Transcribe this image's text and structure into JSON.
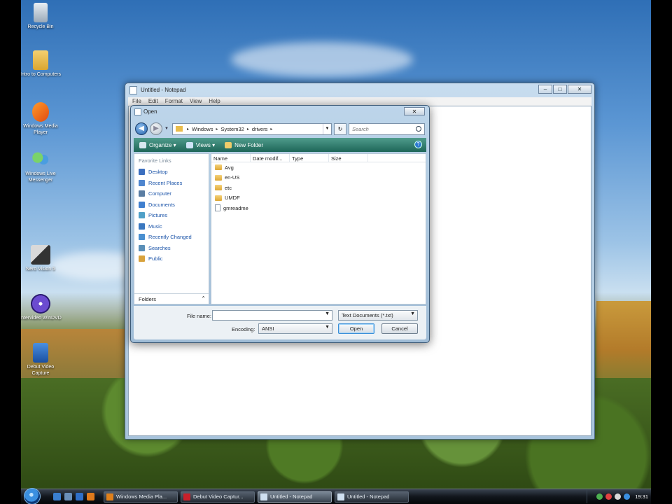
{
  "desktop": {
    "icons": [
      {
        "label": "Recycle Bin"
      },
      {
        "label": "Intro to Computers"
      },
      {
        "label": "Windows Media Player"
      },
      {
        "label": "Windows Live Messenger"
      },
      {
        "label": "Nero Vision 5"
      },
      {
        "label": "Intervideo WinDVD"
      },
      {
        "label": "Debut Video Capture"
      }
    ]
  },
  "notepad": {
    "title": "Untitled - Notepad",
    "menu": [
      "File",
      "Edit",
      "Format",
      "View",
      "Help"
    ],
    "window_buttons": {
      "minimize": "–",
      "maximize": "□",
      "close": "✕"
    }
  },
  "open_dialog": {
    "title": "Open",
    "close_glyph": "✕",
    "address": {
      "crumbs": [
        "Windows",
        "System32",
        "drivers"
      ],
      "separator": "▸"
    },
    "refresh_glyph": "↻",
    "search_placeholder": "Search",
    "toolbar": {
      "organize": "Organize ▾",
      "views": "Views ▾",
      "new_folder": "New Folder",
      "help_glyph": "?"
    },
    "favorite_links_title": "Favorite Links",
    "favorite_links": [
      {
        "label": "Desktop",
        "color": "#3c6fbf"
      },
      {
        "label": "Recent Places",
        "color": "#4f86cf"
      },
      {
        "label": "Computer",
        "color": "#5a7da3"
      },
      {
        "label": "Documents",
        "color": "#3f7fcf"
      },
      {
        "label": "Pictures",
        "color": "#4fa0c8"
      },
      {
        "label": "Music",
        "color": "#3a78c0"
      },
      {
        "label": "Recently Changed",
        "color": "#4a8fd0"
      },
      {
        "label": "Searches",
        "color": "#5a8fb8"
      },
      {
        "label": "Public",
        "color": "#d8a23c"
      }
    ],
    "folders_label": "Folders",
    "folders_chevron": "⌃",
    "columns": [
      "Name",
      "Date modif...",
      "Type",
      "Size"
    ],
    "files": [
      {
        "name": "Avg",
        "kind": "folder"
      },
      {
        "name": "en-US",
        "kind": "folder"
      },
      {
        "name": "etc",
        "kind": "folder"
      },
      {
        "name": "UMDF",
        "kind": "folder"
      },
      {
        "name": "gmreadme",
        "kind": "document"
      }
    ],
    "file_name_label": "File name:",
    "file_name_value": "",
    "file_type_value": "Text Documents (*.txt)",
    "encoding_label": "Encoding:",
    "encoding_value": "ANSI",
    "open_button": "Open",
    "cancel_button": "Cancel"
  },
  "taskbar": {
    "tasks": [
      {
        "label": "Windows Media Pla...",
        "color": "#e0801a",
        "active": false
      },
      {
        "label": "Debut Video Captur...",
        "color": "#c8202a",
        "active": false
      },
      {
        "label": "Untitled - Notepad",
        "color": "#cfe0f0",
        "active": true
      },
      {
        "label": "Untitled - Notepad",
        "color": "#cfe0f0",
        "active": false
      }
    ],
    "clock": "19:31"
  }
}
